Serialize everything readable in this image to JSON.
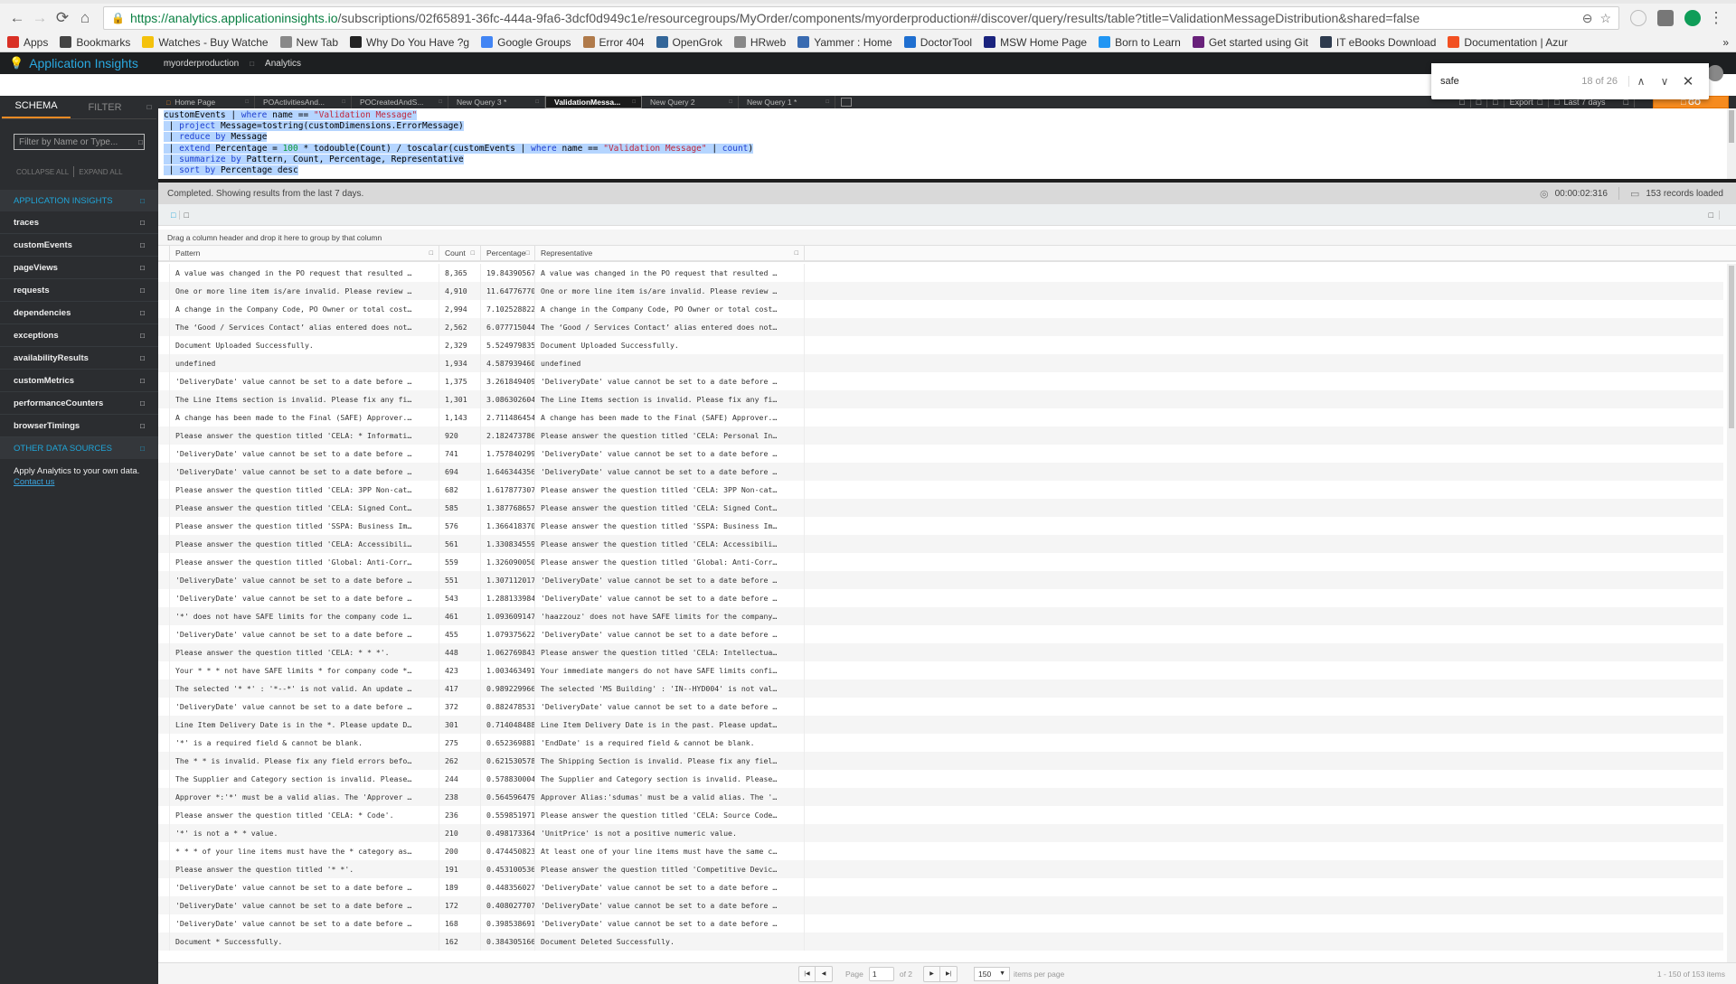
{
  "browser": {
    "url_host": "https://analytics.applicationinsights.io",
    "url_path": "/subscriptions/02f65891-36fc-444a-9fa6-3dcf0d949c1e/resourcegroups/MyOrder/components/myorderproduction#/discover/query/results/table?title=ValidationMessageDistribution&shared=false",
    "bookmarks": [
      {
        "label": "Apps",
        "icon": "apps-grid-icon",
        "color": "#d93025"
      },
      {
        "label": "Bookmarks",
        "icon": "star-icon",
        "color": "#444444"
      },
      {
        "label": "Watches - Buy Watche",
        "icon": "watch-icon",
        "color": "#f4c20d"
      },
      {
        "label": "New Tab",
        "icon": "page-icon",
        "color": "#888888"
      },
      {
        "label": "Why Do You Have ?g",
        "icon": "g-icon",
        "color": "#222222"
      },
      {
        "label": "Google Groups",
        "icon": "groups-icon",
        "color": "#4285f4"
      },
      {
        "label": "Error 404",
        "icon": "error-face-icon",
        "color": "#b07a4a"
      },
      {
        "label": "OpenGrok",
        "icon": "opengrok-icon",
        "color": "#336699"
      },
      {
        "label": "HRweb",
        "icon": "page-icon",
        "color": "#888888"
      },
      {
        "label": "Yammer : Home",
        "icon": "yammer-icon",
        "color": "#396bb1"
      },
      {
        "label": "DoctorTool",
        "icon": "doctortool-icon",
        "color": "#1f6fd0"
      },
      {
        "label": "MSW Home Page",
        "icon": "msw-icon",
        "color": "#1a237e"
      },
      {
        "label": "Born to Learn",
        "icon": "learn-icon",
        "color": "#2196f3"
      },
      {
        "label": "Get started using Git",
        "icon": "vs-icon",
        "color": "#68217a"
      },
      {
        "label": "IT eBooks Download",
        "icon": "ebooks-icon",
        "color": "#2e3b4e"
      },
      {
        "label": "Documentation | Azur",
        "icon": "microsoft-icon",
        "color": "#f25022"
      }
    ],
    "more_bookmarks": "»",
    "find": {
      "query": "safe",
      "count": "18 of 26"
    }
  },
  "app": {
    "title": "Application Insights",
    "breadcrumb": [
      "myorderproduction",
      "Analytics"
    ]
  },
  "sidebar": {
    "tabs": [
      "SCHEMA",
      "FILTER"
    ],
    "filter_placeholder": "Filter by Name or Type...",
    "collapse_all": "COLLAPSE ALL",
    "expand_all": "EXPAND ALL",
    "section_app_insights": "APPLICATION INSIGHTS",
    "tables": [
      "traces",
      "customEvents",
      "pageViews",
      "requests",
      "dependencies",
      "exceptions",
      "availabilityResults",
      "customMetrics",
      "performanceCounters",
      "browserTimings"
    ],
    "section_other": "OTHER DATA SOURCES",
    "note_text": "Apply Analytics to your own data.",
    "note_link": "Contact us"
  },
  "query_tabs": [
    {
      "label": "Home Page",
      "active": false
    },
    {
      "label": "POActivitiesAnd...",
      "active": false
    },
    {
      "label": "POCreatedAndS...",
      "active": false
    },
    {
      "label": "New Query 3 *",
      "active": false
    },
    {
      "label": "ValidationMessa...",
      "active": true
    },
    {
      "label": "New Query 2",
      "active": false
    },
    {
      "label": "New Query 1 *",
      "active": false
    }
  ],
  "toolbar": {
    "export_label": "Export",
    "time_range": "Last 7 days",
    "go_label": "GO"
  },
  "query": {
    "line1_a": "customEvents | ",
    "line1_kw": "where",
    "line1_b": " name == ",
    "line1_str": "\"Validation Message\"",
    "line2_a": " | ",
    "line2_kw": "project",
    "line2_b": " Message=tostring(customDimensions.ErrorMessage)",
    "line3_a": " | ",
    "line3_kw": "reduce by",
    "line3_b": " Message",
    "line4_a": " | ",
    "line4_kw": "extend",
    "line4_b": " Percentage = ",
    "line4_num": "100",
    "line4_c": " * todouble(Count) / toscalar(customEvents | ",
    "line4_kw2": "where",
    "line4_d": " name == ",
    "line4_str": "\"Validation Message\"",
    "line4_e": " | ",
    "line4_kw3": "count",
    "line4_f": ")",
    "line5_a": " | ",
    "line5_kw": "summarize by",
    "line5_b": " Pattern, Count, Percentage, Representative",
    "line6_a": " | ",
    "line6_kw": "sort by",
    "line6_b": " Percentage desc"
  },
  "results": {
    "status": "Completed. Showing results from the last 7 days.",
    "elapsed": "00:00:02:316",
    "records": "153 records loaded",
    "group_hint": "Drag a column header and drop it here to group by that column",
    "columns": [
      "Pattern",
      "Count",
      "Percentage",
      "Representative"
    ],
    "rows": [
      [
        "A value was changed in the PO request that resulted …",
        "8,365",
        "19.8439056792",
        "A value was changed in the PO request that resulted …"
      ],
      [
        "One or more line item is/are invalid. Please review …",
        "4,910",
        "11.6477677089",
        "One or more line item is/are invalid. Please review …"
      ],
      [
        "A change in the Company Code, PO Owner or total cost…",
        "2,994",
        "7.1025288229",
        "A change in the Company Code, PO Owner or total cost…"
      ],
      [
        "The ‘Good / Services Contact’ alias entered does not…",
        "2,562",
        "6.0777150448",
        "The ‘Good / Services Contact’ alias entered does not…"
      ],
      [
        "Document Uploaded Successfully.",
        "2,329",
        "5.5249798358",
        "Document Uploaded Successfully."
      ],
      [
        "undefined",
        "1,934",
        "4.5879394601",
        "undefined"
      ],
      [
        "'DeliveryDate' value cannot be set to a date before …",
        "1,375",
        "3.2618494093",
        "'DeliveryDate' value cannot be set to a date before …"
      ],
      [
        "The Line Items section is invalid. Please fix any fi…",
        "1,301",
        "3.0863026047",
        "The Line Items section is invalid. Please fix any fi…"
      ],
      [
        "A change has been made to the Final (SAFE) Approver.…",
        "1,143",
        "2.7114864544",
        "A change has been made to the Final (SAFE) Approver.…"
      ],
      [
        "Please answer the question titled 'CELA: * Informati…",
        "920",
        "2.1824737866",
        "Please answer the question titled 'CELA: Personal In…"
      ],
      [
        "'DeliveryDate' value cannot be set to a date before …",
        "741",
        "1.7578402999",
        "'DeliveryDate' value cannot be set to a date before …"
      ],
      [
        "'DeliveryDate' value cannot be set to a date before …",
        "694",
        "1.6463443564",
        "'DeliveryDate' value cannot be set to a date before …"
      ],
      [
        "Please answer the question titled 'CELA: 3PP Non-cat…",
        "682",
        "1.6178773070",
        "Please answer the question titled 'CELA: 3PP Non-cat…"
      ],
      [
        "Please answer the question titled 'CELA: Signed Cont…",
        "585",
        "1.3877686578",
        "Please answer the question titled 'CELA: Signed Cont…"
      ],
      [
        "Please answer the question titled 'SSPA: Business Im…",
        "576",
        "1.3664183707",
        "Please answer the question titled 'SSPA: Business Im…"
      ],
      [
        "Please answer the question titled 'CELA: Accessibili…",
        "561",
        "1.3308345590",
        "Please answer the question titled 'CELA: Accessibili…"
      ],
      [
        "Please answer the question titled 'Global: Anti-Corr…",
        "559",
        "1.3260900508",
        "Please answer the question titled 'Global: Anti-Corr…"
      ],
      [
        "'DeliveryDate' value cannot be set to a date before …",
        "551",
        "1.3071120178",
        "'DeliveryDate' value cannot be set to a date before …"
      ],
      [
        "'DeliveryDate' value cannot be set to a date before …",
        "543",
        "1.2881339849",
        "'DeliveryDate' value cannot be set to a date before …"
      ],
      [
        "'*' does not have SAFE limits for the company code i…",
        "461",
        "1.0936091474",
        "'haazzouz' does not have SAFE limits for the company…"
      ],
      [
        "'DeliveryDate' value cannot be set to a date before …",
        "455",
        "1.0793756227",
        "'DeliveryDate' value cannot be set to a date before …"
      ],
      [
        "Please answer the question titled 'CELA: * * *'.",
        "448",
        "1.0627698439",
        "Please answer the question titled 'CELA: Intellectua…"
      ],
      [
        "Your * * * not have SAFE limits * for company code *…",
        "423",
        "1.0034634910",
        "Your immediate mangers do not have SAFE limits confi…"
      ],
      [
        "The selected '* *' : '*--*' is not valid. An update …",
        "417",
        "0.9892299663",
        "The selected 'MS Building' : 'IN--HYD004' is not val…"
      ],
      [
        "'DeliveryDate' value cannot be set to a date before …",
        "372",
        "0.8824785311",
        "'DeliveryDate' value cannot be set to a date before …"
      ],
      [
        "Line Item Delivery Date is in the *. Please update D…",
        "301",
        "0.7140484889",
        "Line Item Delivery Date is in the past. Please updat…"
      ],
      [
        "'*' is a required field & cannot be blank.",
        "275",
        "0.6523698819",
        "'EndDate' is a required field & cannot be blank."
      ],
      [
        "The * * is invalid. Please fix any field errors befo…",
        "262",
        "0.6215305784",
        "The Shipping Section is invalid. Please fix any fiel…"
      ],
      [
        "The Supplier and Category section is invalid. Please…",
        "244",
        "0.5788300043",
        "The Supplier and Category section is invalid. Please…"
      ],
      [
        "Approver *:'*' must be a valid alias. The 'Approver …",
        "238",
        "0.5645964796",
        "Approver Alias:'sdumas' must be a valid alias. The '…"
      ],
      [
        "Please answer the question titled 'CELA: * Code'.",
        "236",
        "0.5598519713",
        "Please answer the question titled 'CELA: Source Code…"
      ],
      [
        "'*' is not a * * value.",
        "210",
        "0.4981733643",
        "'UnitPrice' is not a positive numeric value."
      ],
      [
        "* * * of your line items must have the * category as…",
        "200",
        "0.4744508232",
        "At least one of your line items must have the same c…"
      ],
      [
        "Please answer the question titled '* *'.",
        "191",
        "0.4531005361",
        "Please answer the question titled 'Competitive Devic…"
      ],
      [
        "'DeliveryDate' value cannot be set to a date before …",
        "189",
        "0.4483560279",
        "'DeliveryDate' value cannot be set to a date before …"
      ],
      [
        "'DeliveryDate' value cannot be set to a date before …",
        "172",
        "0.4080277079",
        "'DeliveryDate' value cannot be set to a date before …"
      ],
      [
        "'DeliveryDate' value cannot be set to a date before …",
        "168",
        "0.3985386915",
        "'DeliveryDate' value cannot be set to a date before …"
      ],
      [
        "Document * Successfully.",
        "162",
        "0.3843051668",
        "Document Deleted Successfully."
      ]
    ]
  },
  "pager": {
    "page_label": "Page",
    "page_value": "1",
    "of_label": "of 2",
    "per_page_value": "150",
    "per_page_label": "items per page",
    "summary": "1 - 150 of 153 items"
  }
}
